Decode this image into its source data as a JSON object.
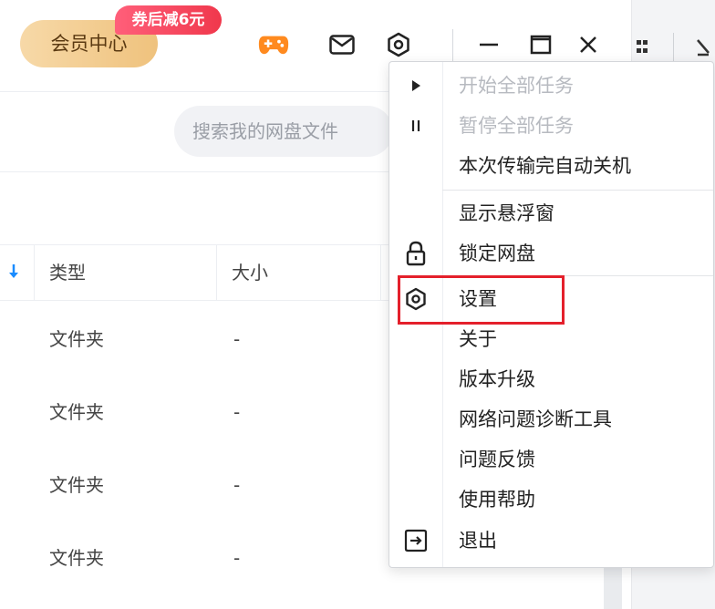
{
  "header": {
    "vip_label": "会员中心",
    "promo_badge": "券后减6元"
  },
  "search": {
    "placeholder": "搜索我的网盘文件"
  },
  "table": {
    "columns": [
      "类型",
      "大小"
    ],
    "rows": [
      {
        "type": "文件夹",
        "size": "-"
      },
      {
        "type": "文件夹",
        "size": "-"
      },
      {
        "type": "文件夹",
        "size": "-"
      },
      {
        "type": "文件夹",
        "size": "-"
      }
    ]
  },
  "menu": {
    "items": [
      {
        "label": "开始全部任务",
        "icon": "play-icon",
        "disabled": true
      },
      {
        "label": "暂停全部任务",
        "icon": "pause-icon",
        "disabled": true
      },
      {
        "label": "本次传输完自动关机",
        "icon": "",
        "disabled": false
      },
      {
        "label": "显示悬浮窗",
        "icon": "",
        "disabled": false
      },
      {
        "label": "锁定网盘",
        "icon": "lock-icon",
        "disabled": false
      },
      {
        "label": "设置",
        "icon": "gear-icon",
        "disabled": false
      },
      {
        "label": "关于",
        "icon": "",
        "disabled": false
      },
      {
        "label": "版本升级",
        "icon": "",
        "disabled": false
      },
      {
        "label": "网络问题诊断工具",
        "icon": "",
        "disabled": false
      },
      {
        "label": "问题反馈",
        "icon": "",
        "disabled": false
      },
      {
        "label": "使用帮助",
        "icon": "",
        "disabled": false
      },
      {
        "label": "退出",
        "icon": "exit-icon",
        "disabled": false
      }
    ]
  },
  "colors": {
    "highlight": "#e4202b",
    "vip_gradient_start": "#f7d9a8",
    "promo_badge": "#f0384c",
    "game_icon": "#ff8a1f",
    "sort_arrow": "#1a8cff"
  }
}
